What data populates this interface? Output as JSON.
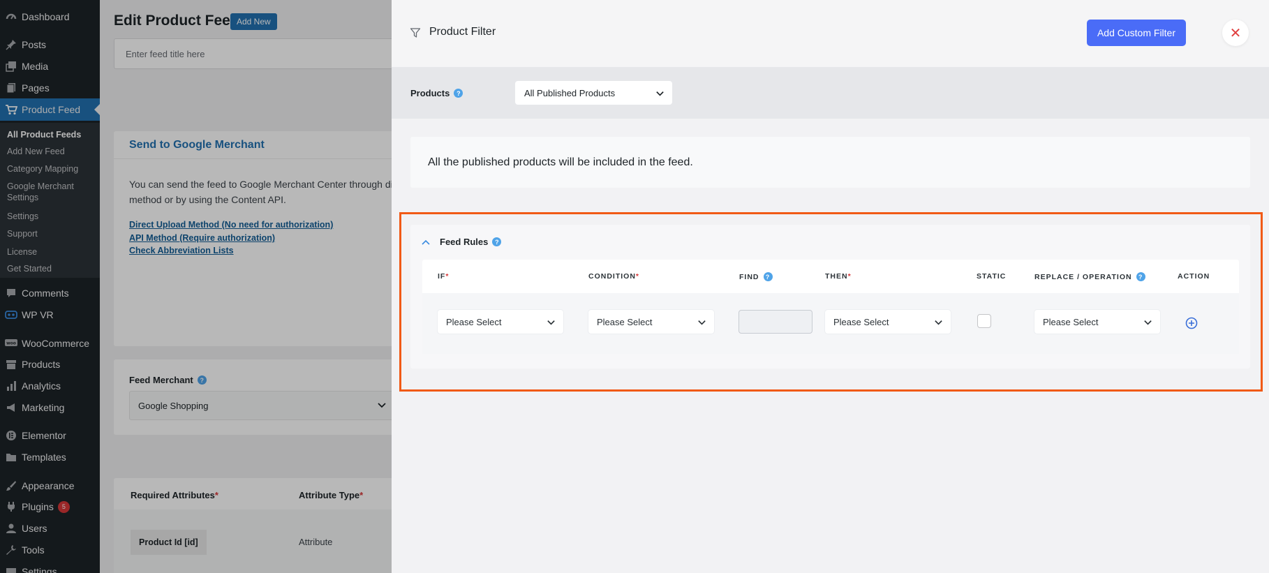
{
  "sidebar": {
    "menu": [
      {
        "label": "Dashboard",
        "icon": "dashboard-icon"
      },
      {
        "label": "Posts",
        "icon": "pin-icon"
      },
      {
        "label": "Media",
        "icon": "media-icon"
      },
      {
        "label": "Pages",
        "icon": "pages-icon"
      },
      {
        "label": "Product Feed",
        "icon": "cart-icon"
      },
      {
        "label": "Comments",
        "icon": "comment-icon"
      },
      {
        "label": "WP VR",
        "icon": "vr-icon"
      },
      {
        "label": "WooCommerce",
        "icon": "woo-icon"
      },
      {
        "label": "Products",
        "icon": "archive-icon"
      },
      {
        "label": "Analytics",
        "icon": "bar-chart-icon"
      },
      {
        "label": "Marketing",
        "icon": "megaphone-icon"
      },
      {
        "label": "Elementor",
        "icon": "elementor-icon"
      },
      {
        "label": "Templates",
        "icon": "folder-icon"
      },
      {
        "label": "Appearance",
        "icon": "brush-icon"
      },
      {
        "label": "Plugins",
        "icon": "plugin-icon",
        "badge": "5"
      },
      {
        "label": "Users",
        "icon": "user-icon"
      },
      {
        "label": "Tools",
        "icon": "wrench-icon"
      },
      {
        "label": "Settings",
        "icon": "settings-icon"
      }
    ],
    "submenu": [
      "All Product Feeds",
      "Add New Feed",
      "Category Mapping",
      "Google Merchant Settings",
      "Settings",
      "Support",
      "License",
      "Get Started"
    ]
  },
  "background_page": {
    "title": "Edit Product Feed",
    "add_new": "Add New",
    "feed_title_placeholder": "Enter feed title here",
    "google_merchant": {
      "heading": "Send to Google Merchant",
      "text_line1": "You can send the feed to Google Merchant Center through direc",
      "text_line2": "method or by using the Content API.",
      "link1": "Direct Upload Method (No need for authorization)",
      "link2": "API Method (Require authorization)",
      "link3": "Check Abbreviation Lists"
    },
    "feed_merchant": {
      "label": "Feed Merchant",
      "value": "Google Shopping"
    },
    "attributes": {
      "col1": "Required Attributes",
      "col2": "Attribute Type",
      "row_attr": "Product Id [id]",
      "row_type": "Attribute"
    }
  },
  "drawer": {
    "title": "Product Filter",
    "add_custom_filter": "Add Custom Filter",
    "close_symbol": "✕",
    "products_label": "Products",
    "products_value": "All Published Products",
    "info_text": "All the published products will be included in the feed.",
    "feed_rules": {
      "title": "Feed Rules",
      "columns": {
        "if": "IF",
        "condition": "CONDITION",
        "find": "FIND",
        "then": "THEN",
        "static": "STATIC",
        "replace": "REPLACE / OPERATION",
        "action": "ACTION"
      },
      "row": {
        "if": "Please Select",
        "condition": "Please Select",
        "then": "Please Select",
        "replace": "Please Select"
      }
    }
  },
  "colors": {
    "sidebar_bg": "#1d2327",
    "wp_blue": "#2271b1",
    "button_blue": "#4a6cf7",
    "highlight": "#f15a16",
    "required": "#d63638"
  }
}
